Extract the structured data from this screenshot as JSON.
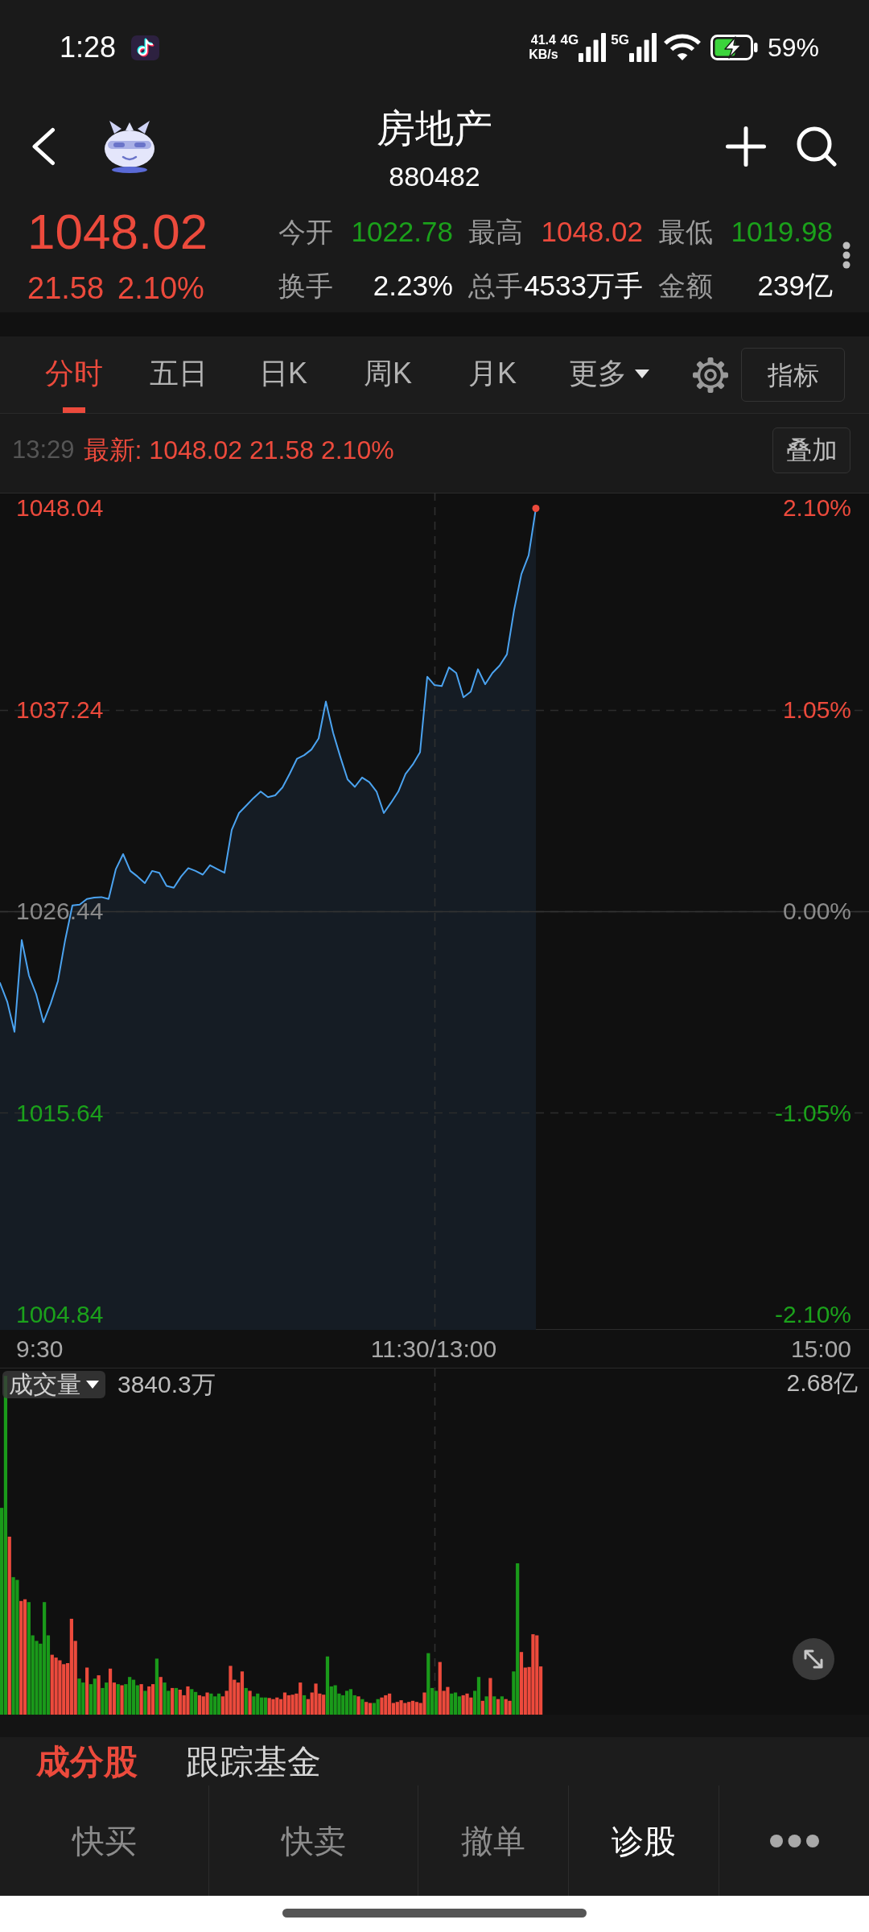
{
  "status_bar": {
    "time": "1:28",
    "net_speed": "41.4",
    "net_unit": "KB/s",
    "networks": [
      "4G",
      "5G"
    ],
    "battery": "59%"
  },
  "header": {
    "title": "房地产",
    "code": "880482"
  },
  "quote": {
    "rising": true,
    "price": "1048.02",
    "change": "21.58",
    "change_percent": "2.10%",
    "stats": [
      {
        "label": "今开",
        "value": "1022.78",
        "color": "#1ba11b"
      },
      {
        "label": "最高",
        "value": "1048.02",
        "color": "#ec4a3c"
      },
      {
        "label": "最低",
        "value": "1019.98",
        "color": "#1ba11b"
      },
      {
        "label": "换手",
        "value": "2.23%",
        "color": "#ffffff"
      },
      {
        "label": "总手",
        "value": "4533万手",
        "color": "#ffffff"
      },
      {
        "label": "金额",
        "value": "239亿",
        "color": "#ffffff"
      }
    ]
  },
  "chart_tabs": [
    {
      "label": "分时",
      "selected": true,
      "kind": "tab"
    },
    {
      "label": "五日",
      "selected": false,
      "kind": "tab"
    },
    {
      "label": "日K",
      "selected": false,
      "kind": "tab"
    },
    {
      "label": "周K",
      "selected": false,
      "kind": "tab"
    },
    {
      "label": "月K",
      "selected": false,
      "kind": "tab"
    },
    {
      "label": "更多",
      "selected": false,
      "kind": "dropdown"
    }
  ],
  "indicator_button": "指标",
  "latest_bar": {
    "time": "13:29",
    "text": "最新: 1048.02 21.58 2.10%",
    "overlay_button": "叠加"
  },
  "price_chart": {
    "chart_data": {
      "type": "area",
      "categories": [
        null,
        null,
        null,
        null,
        null,
        null,
        null,
        null,
        null,
        null,
        null,
        null,
        null,
        null,
        null,
        null,
        null,
        null,
        null,
        null,
        null,
        null,
        null,
        null,
        null,
        null,
        null,
        null,
        null,
        null,
        null,
        null,
        null,
        null,
        null,
        null,
        null,
        null,
        null,
        null,
        null,
        null,
        null,
        null,
        null,
        null,
        null,
        null,
        null,
        null,
        null,
        null,
        null,
        null,
        null,
        null,
        null,
        null,
        null,
        null,
        null,
        null,
        null,
        null,
        null,
        null,
        null,
        null,
        null,
        null,
        null,
        null,
        null,
        null,
        null,
        null,
        null,
        null,
        null,
        null,
        null,
        null,
        null,
        null,
        null,
        null,
        null,
        null,
        null,
        null,
        null,
        null,
        null,
        null,
        null,
        null,
        null,
        null,
        null,
        null,
        null,
        null,
        null,
        null,
        null,
        null,
        null,
        null,
        null,
        null,
        null,
        null,
        null,
        null,
        null,
        null,
        null,
        null,
        null,
        null,
        null
      ],
      "values": [
        1022.6,
        1021.6,
        1019.98,
        1024.9,
        1023.0,
        1022.0,
        1020.5,
        1021.5,
        1022.7,
        1024.9,
        1026.75,
        1026.8,
        1027.1,
        1027.17,
        1027.2,
        1027.1,
        1028.7,
        1029.5,
        1028.6,
        1028.3,
        1027.95,
        1028.6,
        1028.5,
        1027.8,
        1027.7,
        1028.3,
        1028.75,
        1028.6,
        1028.4,
        1028.9,
        1028.7,
        1028.5,
        1030.8,
        1031.7,
        1032.1,
        1032.5,
        1032.85,
        1032.55,
        1032.65,
        1033.07,
        1033.8,
        1034.6,
        1034.8,
        1035.1,
        1035.7,
        1037.67,
        1036.0,
        1034.7,
        1033.5,
        1033.1,
        1033.6,
        1033.35,
        1032.85,
        1031.7,
        1032.25,
        1032.85,
        1033.8,
        1034.3,
        1034.95,
        1039.0,
        1038.55,
        1038.5,
        1039.5,
        1039.2,
        1037.9,
        1038.2,
        1039.4,
        1038.6,
        1039.2,
        1039.6,
        1040.2,
        1042.6,
        1044.5,
        1045.5,
        1048.02,
        null,
        null,
        null,
        null,
        null,
        null,
        null,
        null,
        null,
        null,
        null,
        null,
        null,
        null,
        null,
        null,
        null,
        null,
        null,
        null,
        null,
        null,
        null,
        null,
        null,
        null,
        null,
        null,
        null,
        null,
        null,
        null,
        null,
        null,
        null,
        null,
        null,
        null,
        null,
        null,
        null,
        null,
        null,
        null,
        null,
        null
      ],
      "ylim": [
        1004.02,
        1048.86
      ],
      "yticks": [
        {
          "value": 1048.04,
          "label": "1048.04"
        },
        {
          "value": 1037.24,
          "label": "1037.24"
        },
        {
          "value": 1026.44,
          "label": "1026.44"
        },
        {
          "value": 1015.64,
          "label": "1015.64"
        },
        {
          "value": 1004.84,
          "label": "1004.84"
        }
      ],
      "ref_lines": [
        {
          "axis": "y",
          "value": 1026.44
        }
      ]
    },
    "percent_labels": [
      "2.10%",
      "1.05%",
      "0.00%",
      "-1.05%",
      "-2.10%"
    ],
    "time_labels": [
      "9:30",
      "11:30/13:00",
      "15:00"
    ]
  },
  "volume": {
    "selector": "成交量",
    "current": "3840.3万",
    "max": "2.68亿"
  },
  "bottom_tabs": [
    {
      "label": "成分股",
      "selected": true
    },
    {
      "label": "跟踪基金",
      "selected": false
    }
  ],
  "toolbar": [
    {
      "label": "快买",
      "selected": false
    },
    {
      "label": "快卖",
      "selected": false
    },
    {
      "label": "撤单",
      "selected": false
    },
    {
      "label": "诊股",
      "selected": true
    }
  ]
}
